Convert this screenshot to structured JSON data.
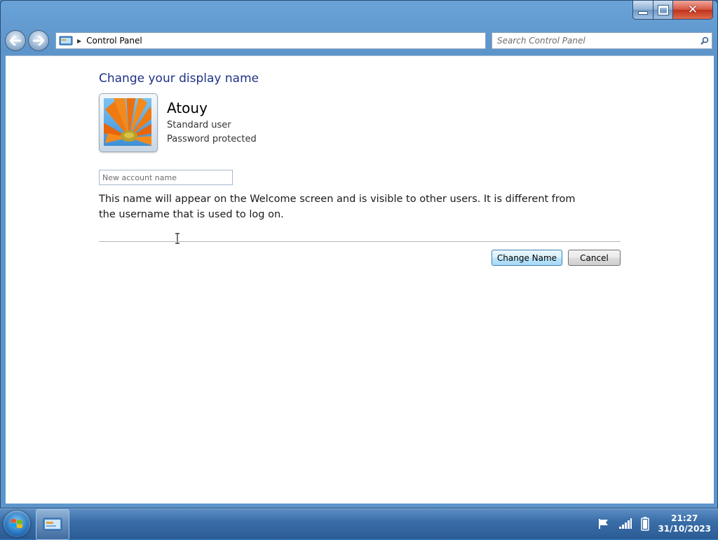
{
  "window": {
    "buttons": {
      "minimize_icon": "minimize-icon",
      "maximize_icon": "maximize-icon",
      "close_glyph": "✕"
    }
  },
  "navigation": {
    "back_icon": "back-arrow-icon",
    "forward_icon": "forward-arrow-icon",
    "breadcrumb": [
      "Control Panel"
    ]
  },
  "search": {
    "placeholder": "Search Control Panel",
    "value": ""
  },
  "page": {
    "heading": "Change your display name",
    "user": {
      "name": "Atouy",
      "type": "Standard user",
      "status": "Password protected"
    },
    "name_input": {
      "placeholder": "New account name",
      "value": ""
    },
    "description": "This name will appear on the Welcome screen and is visible to other users. It is different from the username that is used to log on.",
    "buttons": {
      "change": "Change Name",
      "cancel": "Cancel"
    }
  },
  "taskbar": {
    "clock": {
      "time": "21:27",
      "date": "31/10/2023"
    },
    "tray_icons": [
      "action-center-flag-icon",
      "network-signal-icon",
      "battery-icon"
    ]
  },
  "colors": {
    "heading": "#1e3287",
    "primary_button_border": "#3c7fb1",
    "window_frame": "#6aa3d7"
  }
}
